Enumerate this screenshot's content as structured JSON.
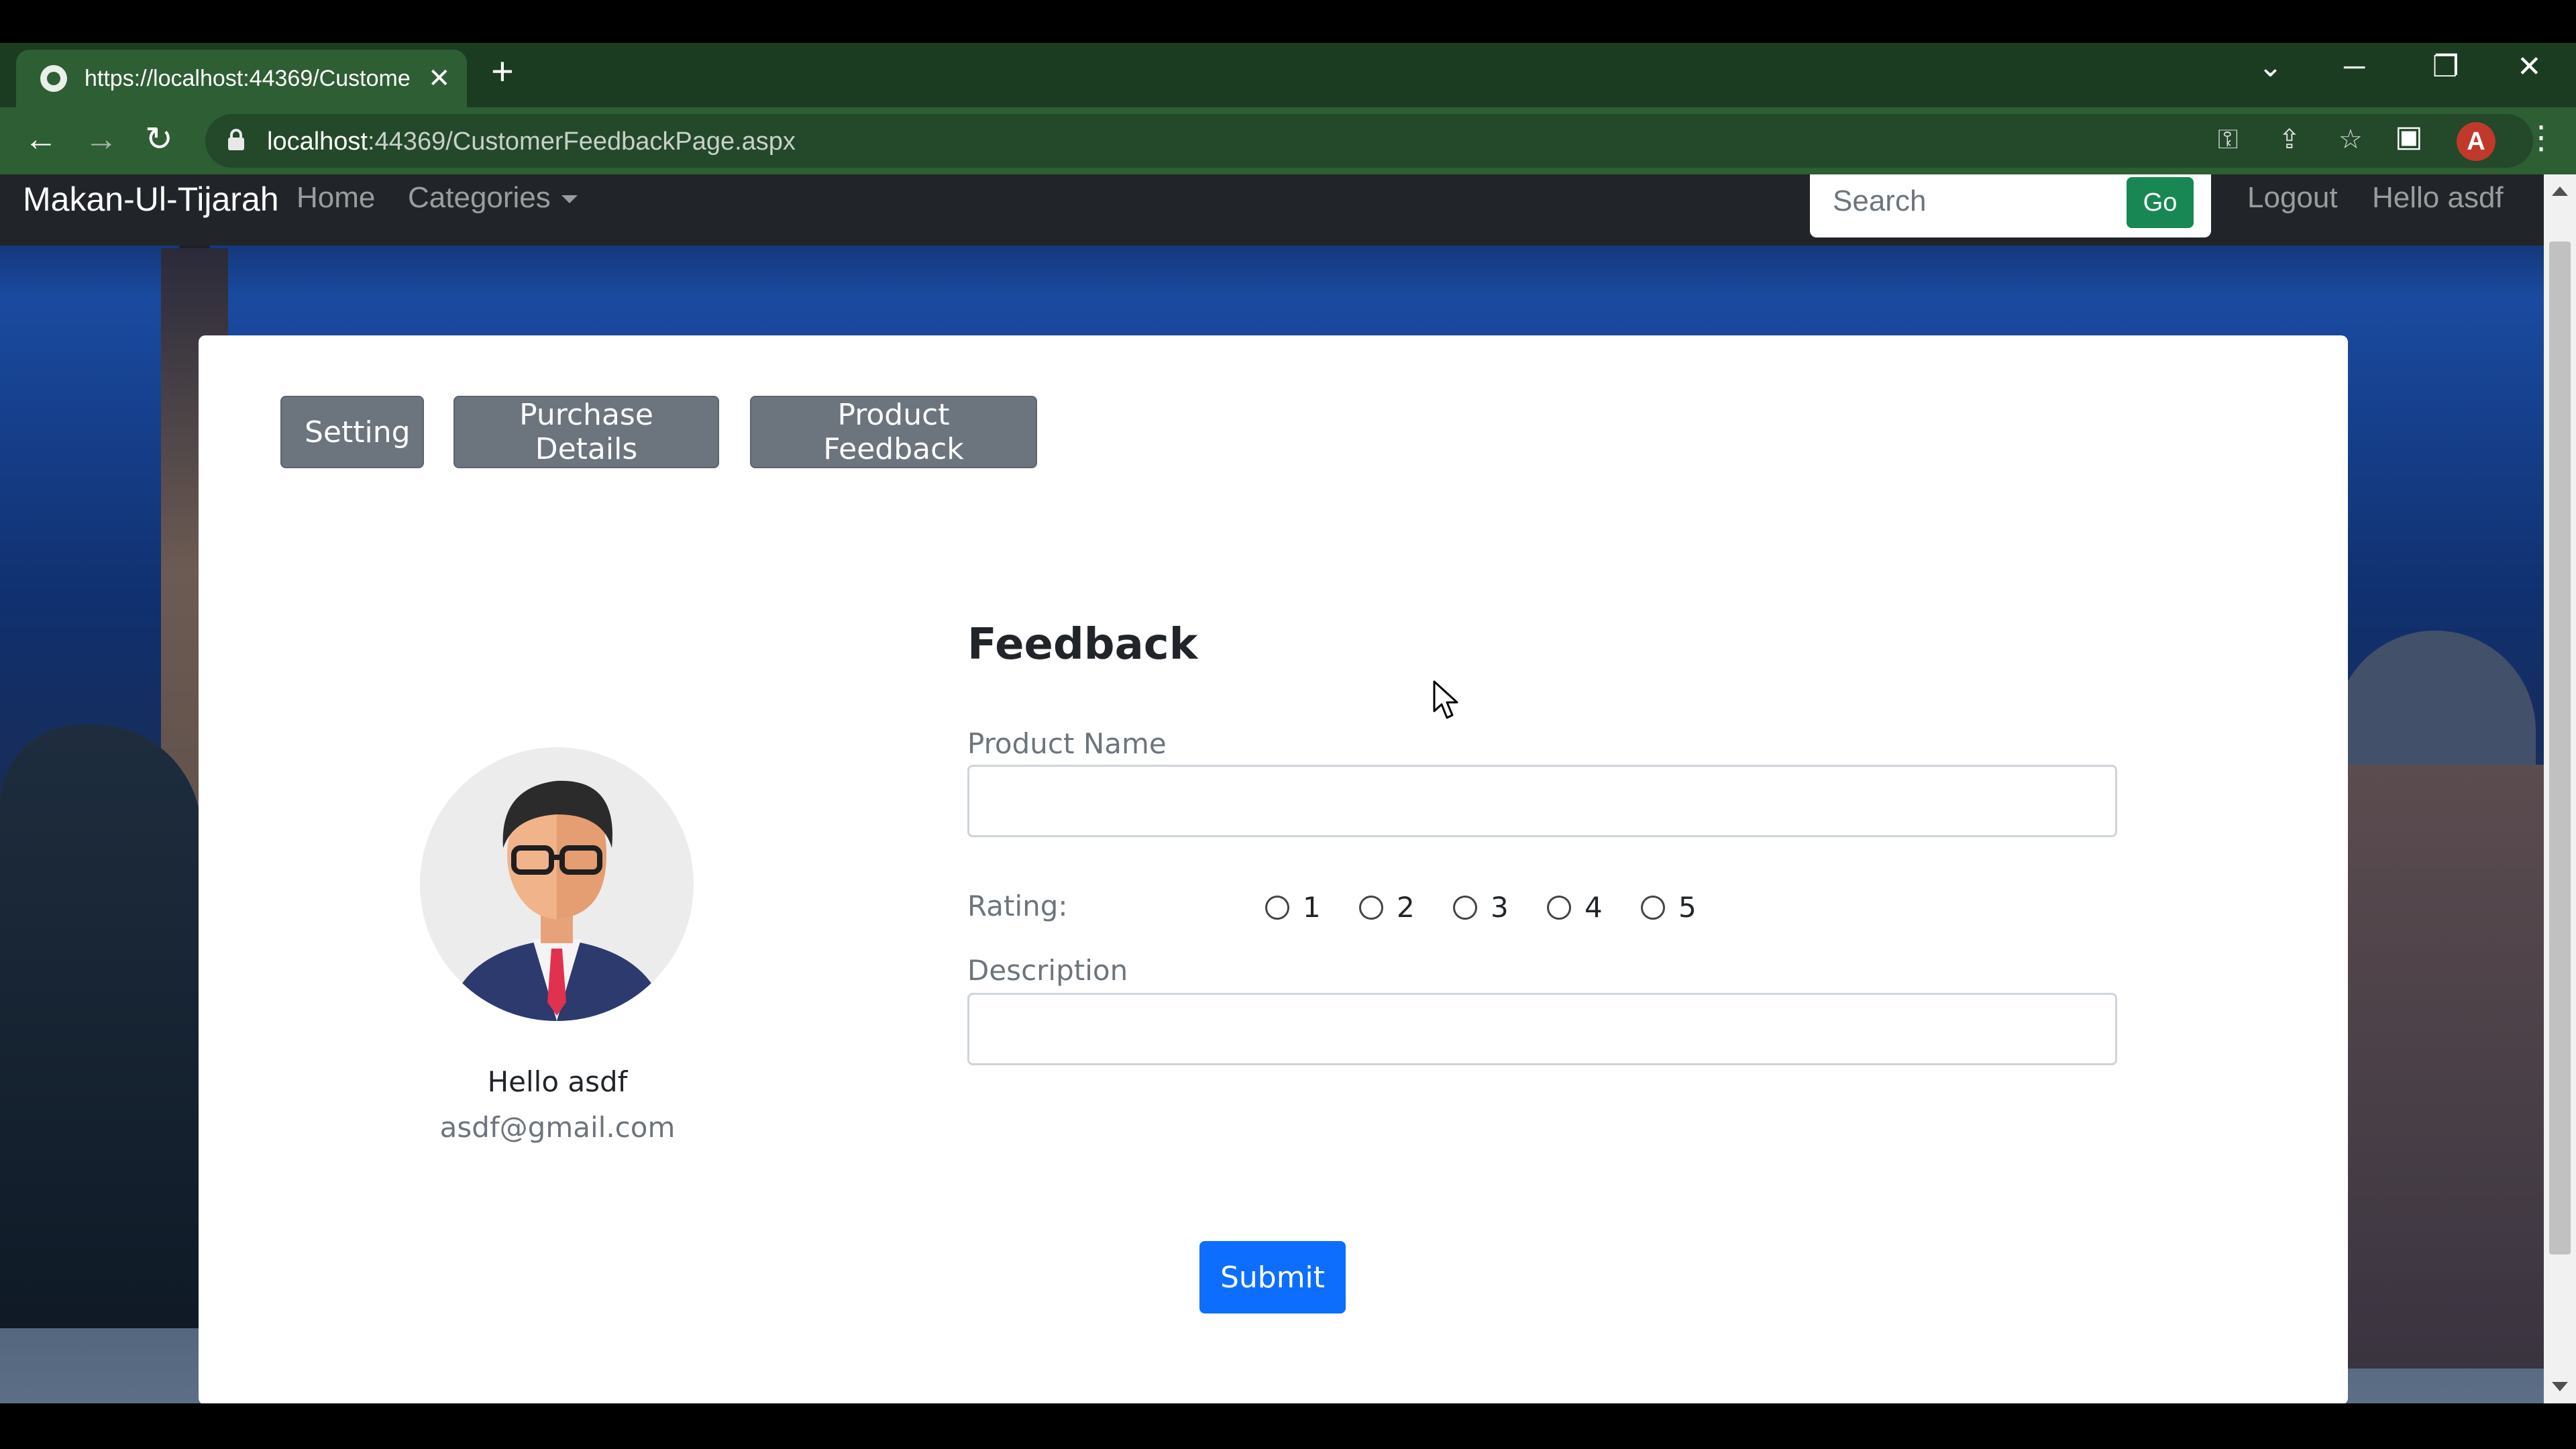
{
  "browser": {
    "tab_title": "https://localhost:44369/Custome",
    "tab_close": "✕",
    "new_tab": "+",
    "url_host": "localhost",
    "url_rest": ":44369/CustomerFeedbackPage.aspx",
    "profile_initial": "A",
    "back": "←",
    "forward": "→",
    "reload": "↻",
    "minimize": "─",
    "restore": "❐",
    "close": "✕",
    "tab_search": "⌄",
    "key_icon": "⚿",
    "share_icon": "⇪",
    "star_icon": "☆",
    "sidepanel_icon": "▣",
    "menu": "⋮"
  },
  "navbar": {
    "brand": "Makan-Ul-Tijarah",
    "home": "Home",
    "categories": "Categories",
    "search_placeholder": "Search",
    "go_label": "Go",
    "logout": "Logout",
    "hello": "Hello asdf"
  },
  "page": {
    "buttons": {
      "setting": "Setting",
      "purchase_details": "Purchase Details",
      "product_feedback": "Product Feedback"
    },
    "user": {
      "name": "Hello asdf",
      "email": "asdf@gmail.com"
    },
    "form": {
      "title": "Feedback",
      "product_name_label": "Product Name",
      "product_name_value": "",
      "rating_label": "Rating:",
      "rating_options": [
        "1",
        "2",
        "3",
        "4",
        "5"
      ],
      "description_label": "Description",
      "description_value": "",
      "submit_label": "Submit"
    }
  },
  "colors": {
    "browser_tabbar": "#1c3c21",
    "browser_toolbar": "#2e5e34",
    "navbar": "#212529",
    "go_button": "#198754",
    "gray_button": "#6c757d",
    "submit_button": "#0d6efd"
  }
}
